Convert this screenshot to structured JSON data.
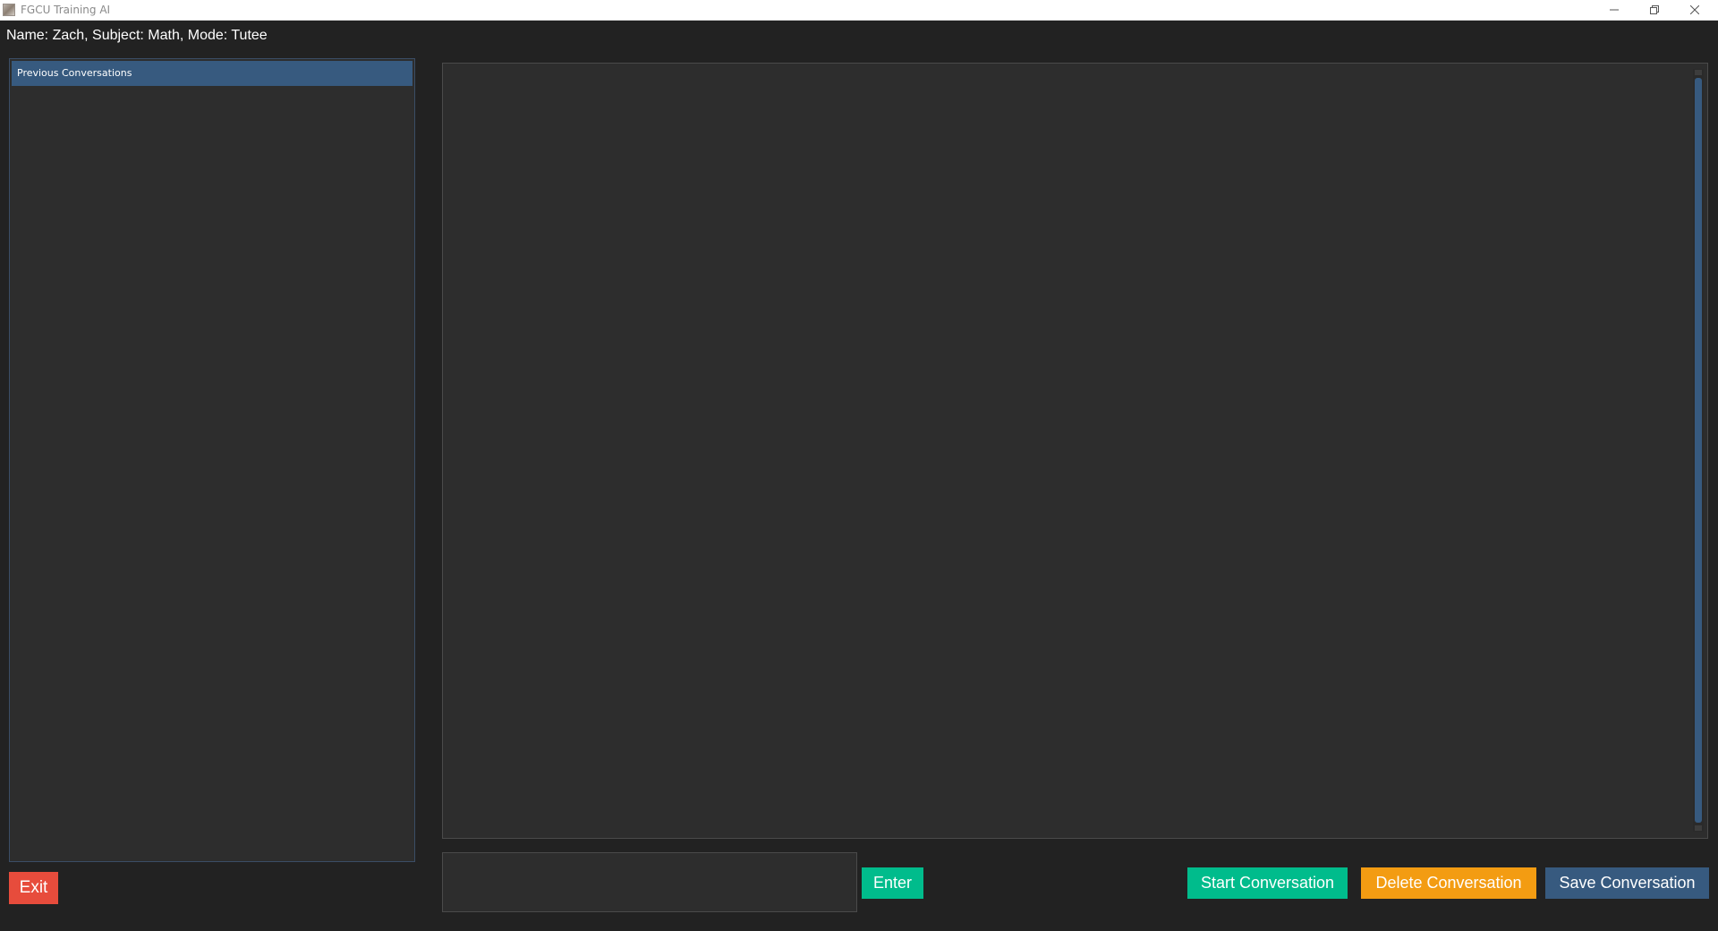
{
  "window": {
    "title": "FGCU Training AI",
    "controls": {
      "minimize_icon": "minimize-icon",
      "maximize_icon": "restore-icon",
      "close_icon": "close-icon"
    }
  },
  "header": {
    "session_info": "Name: Zach, Subject: Math, Mode: Tutee"
  },
  "sidebar": {
    "list_header": "Previous Conversations",
    "items": []
  },
  "chat": {
    "messages": [],
    "input_value": "",
    "input_placeholder": ""
  },
  "buttons": {
    "exit": "Exit",
    "enter": "Enter",
    "start": "Start Conversation",
    "delete": "Delete Conversation",
    "save": "Save Conversation"
  },
  "colors": {
    "background": "#222222",
    "panel": "#2d2d2d",
    "primary": "#375a7f",
    "success": "#00bc8c",
    "warning": "#f39c12",
    "danger": "#e74c3c"
  }
}
